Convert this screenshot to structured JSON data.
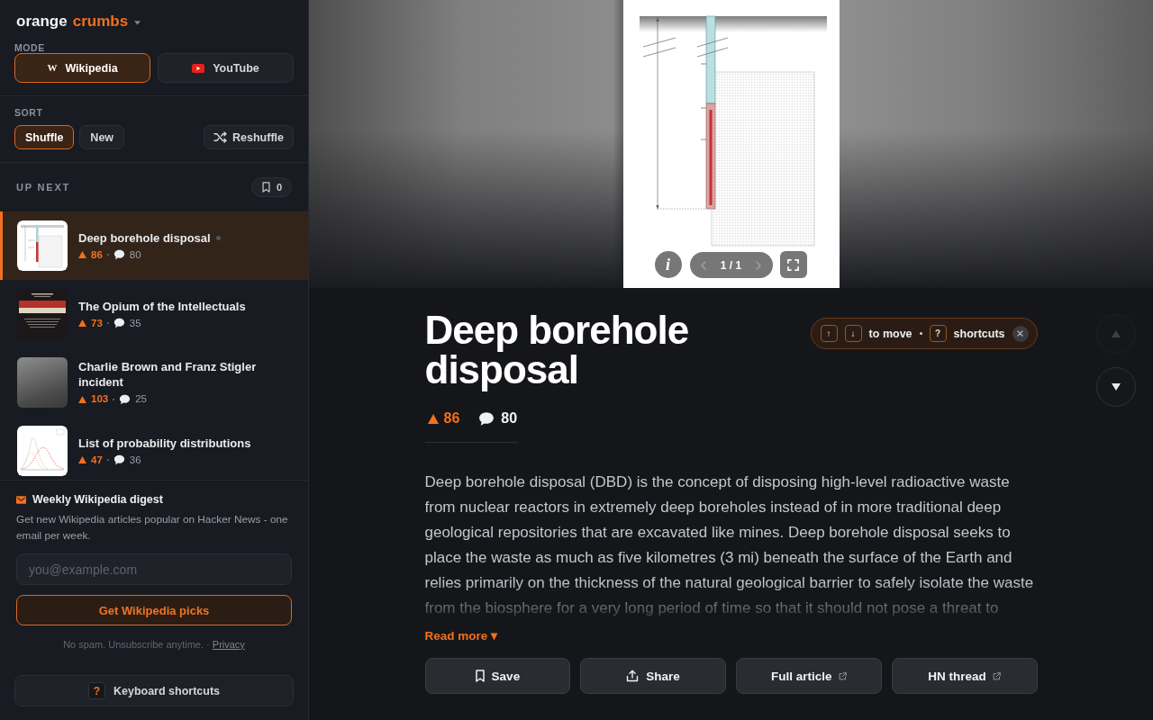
{
  "sidebar": {
    "logo": {
      "primary": "orange",
      "accent": "crumbs"
    },
    "mode": {
      "label": "MODE",
      "options": [
        {
          "kind": "wikipedia",
          "glyph": "W",
          "label": "Wikipedia",
          "selected": true
        },
        {
          "kind": "youtube",
          "label": "YouTube",
          "selected": false
        }
      ]
    },
    "sort": {
      "label": "SORT",
      "options": [
        {
          "label": "Shuffle",
          "selected": true
        },
        {
          "label": "New",
          "selected": false
        }
      ],
      "reshuffle": "Reshuffle"
    },
    "up_next": {
      "label": "UP NEXT",
      "saved_count": "0",
      "items": [
        {
          "kind": "diagram",
          "title": "Deep borehole disposal",
          "score": "86",
          "comments": "80",
          "status_dot": true,
          "selected": true
        },
        {
          "kind": "book",
          "title": "The Opium of the Intellectuals",
          "score": "73",
          "comments": "35",
          "status_dot": false,
          "selected": false
        },
        {
          "kind": "photo",
          "title": "Charlie Brown and Franz Stigler incident",
          "score": "103",
          "comments": "25",
          "status_dot": false,
          "selected": false
        },
        {
          "kind": "plot",
          "title": "List of probability distributions",
          "score": "47",
          "comments": "36",
          "status_dot": false,
          "selected": false
        }
      ]
    },
    "digest": {
      "title": "Weekly Wikipedia digest",
      "description": "Get new Wikipedia articles popular on Hacker News - one email per week.",
      "email_placeholder": "you@example.com",
      "button": "Get Wikipedia picks",
      "note": "No spam. Unsubscribe anytime. ·",
      "privacy_link": "Privacy"
    },
    "shortcuts_button": {
      "key": "?",
      "label": "Keyboard shortcuts"
    }
  },
  "viewer": {
    "info": "i",
    "counter": "1 / 1",
    "prev_disabled": true,
    "next_disabled": true
  },
  "article": {
    "title": "Deep borehole disposal",
    "score": "86",
    "comments": "80",
    "summary": "Deep borehole disposal (DBD) is the concept of disposing high-level radioactive waste from nuclear reactors in extremely deep boreholes instead of in more traditional deep geological repositories that are excavated like mines. Deep borehole disposal seeks to place the waste as much as five kilometres (3 mi) beneath the surface of the Earth and relies primarily on the thickness of the natural geological barrier to safely isolate the waste from the biosphere for a very long period of time so that it should not pose a threat to",
    "read_more": "Read more ▾",
    "actions": [
      {
        "kind": "save",
        "label": "Save"
      },
      {
        "kind": "share",
        "label": "Share"
      },
      {
        "kind": "external",
        "label": "Full article"
      },
      {
        "kind": "external",
        "label": "HN thread"
      }
    ]
  },
  "shortcut_hint": {
    "move_keys": [
      "↑",
      "↓"
    ],
    "move_label": "to move",
    "help_key": "?",
    "help_label": "shortcuts"
  },
  "nav_buttons": [
    {
      "kind": "up",
      "disabled": true
    },
    {
      "kind": "down",
      "disabled": false
    }
  ]
}
